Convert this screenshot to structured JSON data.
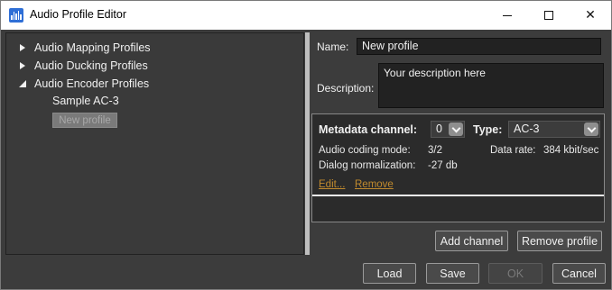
{
  "window": {
    "title": "Audio Profile Editor"
  },
  "tree": {
    "items": [
      {
        "label": "Audio Mapping Profiles",
        "expanded": false
      },
      {
        "label": "Audio Ducking Profiles",
        "expanded": false
      },
      {
        "label": "Audio Encoder Profiles",
        "expanded": true
      }
    ],
    "children": [
      "Sample AC-3"
    ],
    "selected": "New profile"
  },
  "form": {
    "name_label": "Name:",
    "name_value": "New profile",
    "description_label": "Description:",
    "description_value": "Your description here"
  },
  "metadata": {
    "channel_label": "Metadata channel:",
    "channel_value": "0",
    "type_label": "Type:",
    "type_value": "AC-3",
    "coding_mode_label": "Audio coding mode:",
    "coding_mode_value": "3/2",
    "data_rate_label": "Data rate:",
    "data_rate_value": "384 kbit/sec",
    "dialog_norm_label": "Dialog normalization:",
    "dialog_norm_value": "-27 db",
    "edit_link": "Edit...",
    "remove_link": "Remove"
  },
  "buttons": {
    "add_channel": "Add channel",
    "remove_profile": "Remove profile",
    "load": "Load",
    "save": "Save",
    "ok": "OK",
    "cancel": "Cancel"
  },
  "colors": {
    "panel_bg": "#3c3c3c",
    "link": "#c08a2e",
    "app_icon": "#2f6fd6"
  }
}
